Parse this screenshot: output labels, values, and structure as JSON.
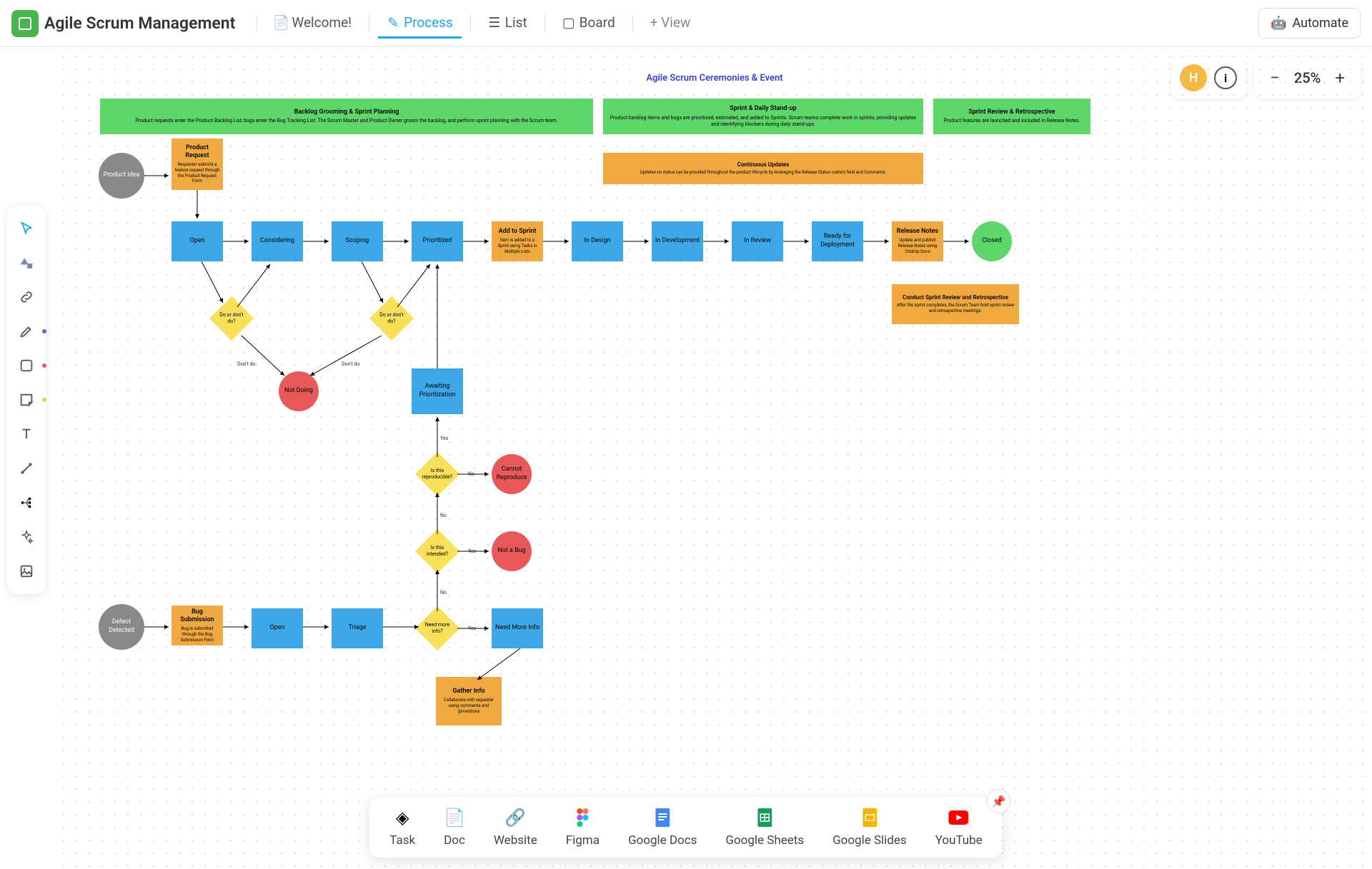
{
  "header": {
    "title": "Agile Scrum Management",
    "tabs": [
      {
        "label": "Welcome!",
        "icon": "doc-pin"
      },
      {
        "label": "Process",
        "icon": "whiteboard",
        "active": true
      },
      {
        "label": "List",
        "icon": "list"
      },
      {
        "label": "Board",
        "icon": "board"
      }
    ],
    "add_view": "+ View",
    "automate": "Automate"
  },
  "user": {
    "initial": "H"
  },
  "zoom": {
    "value": "25%"
  },
  "tools": [
    {
      "name": "select-tool",
      "active": true,
      "dot": null
    },
    {
      "name": "shapes-tool",
      "dot": null
    },
    {
      "name": "link-tool",
      "dot": null
    },
    {
      "name": "pen-tool",
      "dot": "#6b5bd8"
    },
    {
      "name": "rectangle-tool",
      "dot": "#e85a5a"
    },
    {
      "name": "sticky-note-tool",
      "dot": "#f5c95a"
    },
    {
      "name": "text-tool",
      "dot": null
    },
    {
      "name": "connector-tool",
      "dot": null
    },
    {
      "name": "mindmap-tool",
      "dot": null
    },
    {
      "name": "ai-tool",
      "dot": null
    },
    {
      "name": "image-tool",
      "dot": null
    }
  ],
  "diagram": {
    "title": "Agile Scrum Ceremonies & Event",
    "phases": [
      {
        "title": "Backlog Grooming & Sprint Planning",
        "sub": "Product requests enter the Product Backlog List, bugs enter the Bug Tracking List. The Scrum Master and Product Owner groom the backlog, and perform sprint planning with the Scrum team."
      },
      {
        "title": "Sprint & Daily Stand-up",
        "sub": "Product backlog items and bugs are prioritized, estimated, and added to Sprints. Scrum teams complete work in sprints, providing updates and identifying blockers during daily stand-ups."
      },
      {
        "title": "Sprint Review & Retrospective",
        "sub": "Product features are launched and included in Release Notes."
      }
    ],
    "continuous": {
      "title": "Continuous Updates",
      "sub": "Updates on status can be provided throughout the product lifecycle by leveraging the Release Status custom field and Comments."
    },
    "nodes": {
      "product_idea": "Product Idea",
      "product_request": {
        "title": "Product Request",
        "sub": "Requester submits a feature request through the Product Request Form"
      },
      "open": "Open",
      "considering": "Considering",
      "scoping": "Scoping",
      "prioritized": "Prioritized",
      "add_sprint": {
        "title": "Add to Sprint",
        "sub": "Item is added to a Sprint using Tasks in Multiple Lists"
      },
      "in_design": "In Design",
      "in_dev": "In Development",
      "in_review": "In Review",
      "ready_deploy": "Ready for Deployment",
      "release_notes": {
        "title": "Release Notes",
        "sub": "Update and publish Release Notes using ClickUp Docs"
      },
      "closed": "Closed",
      "retro": {
        "title": "Conduct Sprint Review and Retrospective",
        "sub": "After the sprint completes, the Scrum Team hold sprint review and retrospective meetings."
      },
      "do_dont1": "Do or don't do?",
      "do_dont2": "Do or don't do?",
      "not_doing": "Not Doing",
      "awaiting": "Awaiting Prioritization",
      "reproducible": "Is this reproducible?",
      "cannot_repro": "Cannot Reproduce",
      "intended": "Is this intended?",
      "not_bug": "Not a Bug",
      "need_more": "Need more info?",
      "need_more_info": "Need More Info",
      "gather": {
        "title": "Gather Info",
        "sub": "Collaborate with requester using comments and @mentions"
      },
      "defect": "Defect Detected",
      "bug_sub": {
        "title": "Bug Submission",
        "sub": "Bug is submitted through the Bug Submission Form"
      },
      "open2": "Open",
      "triage": "Triage"
    },
    "labels": {
      "dont_do": "Don't do",
      "yes": "Yes",
      "no": "No"
    }
  },
  "bottom_bar": [
    {
      "label": "Task",
      "icon": "task"
    },
    {
      "label": "Doc",
      "icon": "doc"
    },
    {
      "label": "Website",
      "icon": "link"
    },
    {
      "label": "Figma",
      "icon": "figma"
    },
    {
      "label": "Google Docs",
      "icon": "gdocs"
    },
    {
      "label": "Google Sheets",
      "icon": "gsheets"
    },
    {
      "label": "Google Slides",
      "icon": "gslides"
    },
    {
      "label": "YouTube",
      "icon": "youtube"
    }
  ]
}
